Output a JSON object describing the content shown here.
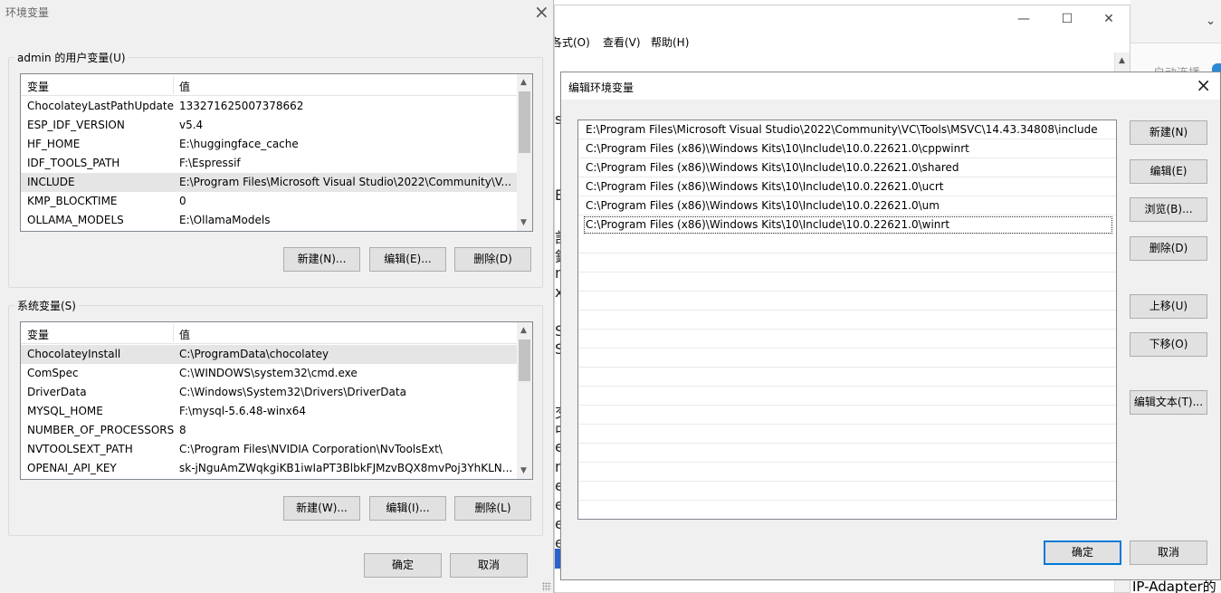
{
  "bg_window": {
    "menu": [
      "格式(O)",
      "查看(V)",
      "帮助(H)"
    ],
    "menu_display": [
      "各式(O)",
      "查看(V)",
      "帮助(H)"
    ],
    "controls": {
      "minimize": "—",
      "maximize": "☐",
      "close": "✕"
    },
    "snippets": [
      "s",
      "E",
      "訁",
      "鉎",
      "m",
      "x",
      "S",
      "S",
      "交",
      "中",
      "e",
      "n",
      "e",
      "e",
      "e",
      "e"
    ]
  },
  "right_strip": {
    "faint_text": "自动连播",
    "bottom_text": "IP-Adapter的"
  },
  "env_dialog": {
    "title": "环境变量",
    "user_group_label": "admin 的用户变量(U)",
    "system_group_label": "系统变量(S)",
    "col_variable": "变量",
    "col_value": "值",
    "user_vars": [
      {
        "name": "ChocolateyLastPathUpdate",
        "value": "133271625007378662"
      },
      {
        "name": "ESP_IDF_VERSION",
        "value": "v5.4"
      },
      {
        "name": "HF_HOME",
        "value": "E:\\huggingface_cache"
      },
      {
        "name": "IDF_TOOLS_PATH",
        "value": "F:\\Espressif"
      },
      {
        "name": "INCLUDE",
        "value": "E:\\Program Files\\Microsoft Visual Studio\\2022\\Community\\V..."
      },
      {
        "name": "KMP_BLOCKTIME",
        "value": "0"
      },
      {
        "name": "OLLAMA_MODELS",
        "value": "E:\\OllamaModels"
      }
    ],
    "user_selected_index": 4,
    "user_scroll_fraction": 0.4,
    "system_vars": [
      {
        "name": "ChocolateyInstall",
        "value": "C:\\ProgramData\\chocolatey"
      },
      {
        "name": "ComSpec",
        "value": "C:\\WINDOWS\\system32\\cmd.exe"
      },
      {
        "name": "DriverData",
        "value": "C:\\Windows\\System32\\Drivers\\DriverData"
      },
      {
        "name": "MYSQL_HOME",
        "value": "F:\\mysql-5.6.48-winx64"
      },
      {
        "name": "NUMBER_OF_PROCESSORS",
        "value": "8"
      },
      {
        "name": "NVTOOLSEXT_PATH",
        "value": "C:\\Program Files\\NVIDIA Corporation\\NvToolsExt\\"
      },
      {
        "name": "OPENAI_API_KEY",
        "value": "sk-jNguAmZWqkgiKB1iwIaPT3BlbkFJMzvBQX8mvPoj3YhKLN..."
      }
    ],
    "system_selected_index": 0,
    "user_buttons": {
      "new": "新建(N)...",
      "edit": "编辑(E)...",
      "delete": "删除(D)"
    },
    "system_buttons": {
      "new": "新建(W)...",
      "edit": "编辑(I)...",
      "delete": "删除(L)"
    },
    "ok": "确定",
    "cancel": "取消"
  },
  "edit_dialog": {
    "title": "编辑环境变量",
    "entries": [
      "E:\\Program Files\\Microsoft Visual Studio\\2022\\Community\\VC\\Tools\\MSVC\\14.43.34808\\include",
      "C:\\Program Files (x86)\\Windows Kits\\10\\Include\\10.0.22621.0\\cppwinrt",
      "C:\\Program Files (x86)\\Windows Kits\\10\\Include\\10.0.22621.0\\shared",
      "C:\\Program Files (x86)\\Windows Kits\\10\\Include\\10.0.22621.0\\ucrt",
      "C:\\Program Files (x86)\\Windows Kits\\10\\Include\\10.0.22621.0\\um",
      "C:\\Program Files (x86)\\Windows Kits\\10\\Include\\10.0.22621.0\\winrt"
    ],
    "focused_index": 5,
    "buttons": {
      "new": "新建(N)",
      "edit": "编辑(E)",
      "browse": "浏览(B)...",
      "delete": "删除(D)",
      "move_up": "上移(U)",
      "move_down": "下移(O)",
      "edit_text": "编辑文本(T)..."
    },
    "ok": "确定",
    "cancel": "取消"
  }
}
